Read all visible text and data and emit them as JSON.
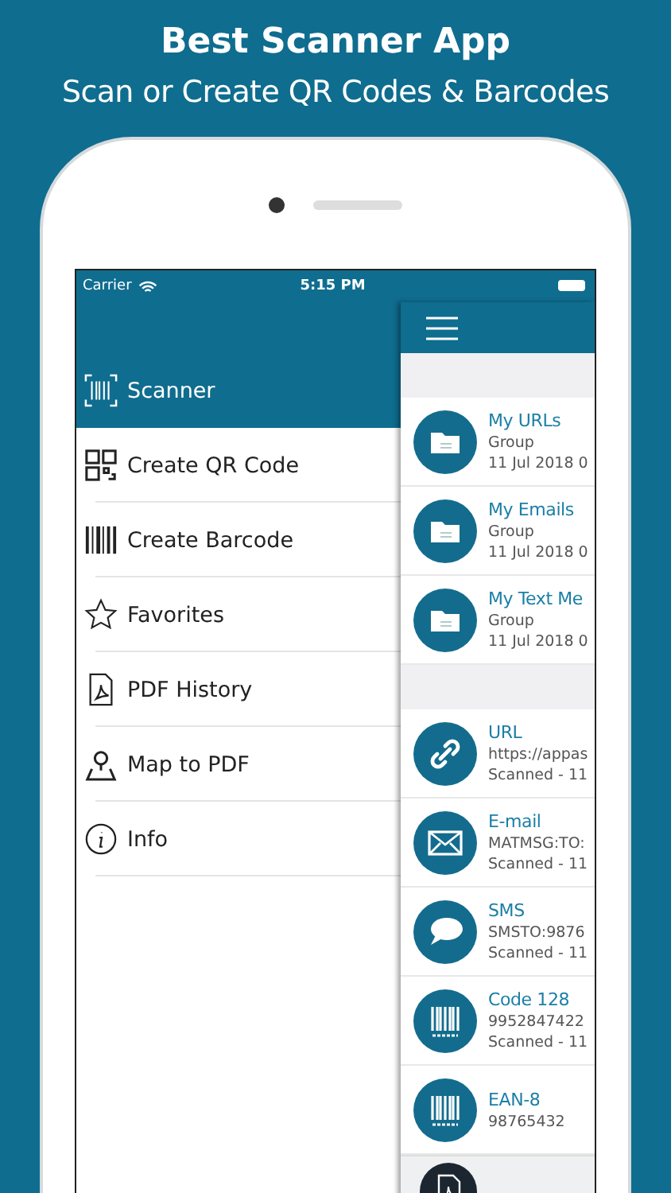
{
  "headline": {
    "title": "Best Scanner App",
    "subtitle": "Scan or Create QR Codes & Barcodes"
  },
  "status_bar": {
    "carrier": "Carrier",
    "time": "5:15 PM"
  },
  "menu": [
    {
      "kind": "scanner",
      "label": "Scanner",
      "selected": true
    },
    {
      "kind": "qr",
      "label": "Create QR Code",
      "selected": false
    },
    {
      "kind": "barcode",
      "label": "Create Barcode",
      "selected": false
    },
    {
      "kind": "star",
      "label": "Favorites",
      "selected": false
    },
    {
      "kind": "pdf",
      "label": "PDF History",
      "selected": false
    },
    {
      "kind": "map",
      "label": "Map to PDF",
      "selected": false
    },
    {
      "kind": "info",
      "label": "Info",
      "selected": false
    }
  ],
  "groups": [
    {
      "kind": "folder",
      "title": "My URLs",
      "subtitle": "Group",
      "date": "11 Jul 2018 0"
    },
    {
      "kind": "folder",
      "title": "My Emails",
      "subtitle": "Group",
      "date": "11 Jul 2018 0"
    },
    {
      "kind": "folder",
      "title": "My Text Me",
      "subtitle": "Group",
      "date": "11 Jul 2018 0"
    }
  ],
  "scans": [
    {
      "kind": "link",
      "title": "URL",
      "subtitle": "https://appas",
      "date": "Scanned - 11"
    },
    {
      "kind": "mail",
      "title": "E-mail",
      "subtitle": "MATMSG:TO:",
      "date": "Scanned - 11"
    },
    {
      "kind": "chat",
      "title": "SMS",
      "subtitle": "SMSTO:9876",
      "date": "Scanned - 11"
    },
    {
      "kind": "barcode",
      "title": "Code 128",
      "subtitle": "9952847422",
      "date": "Scanned - 11"
    },
    {
      "kind": "barcode",
      "title": "EAN-8",
      "subtitle": "98765432"
    }
  ]
}
